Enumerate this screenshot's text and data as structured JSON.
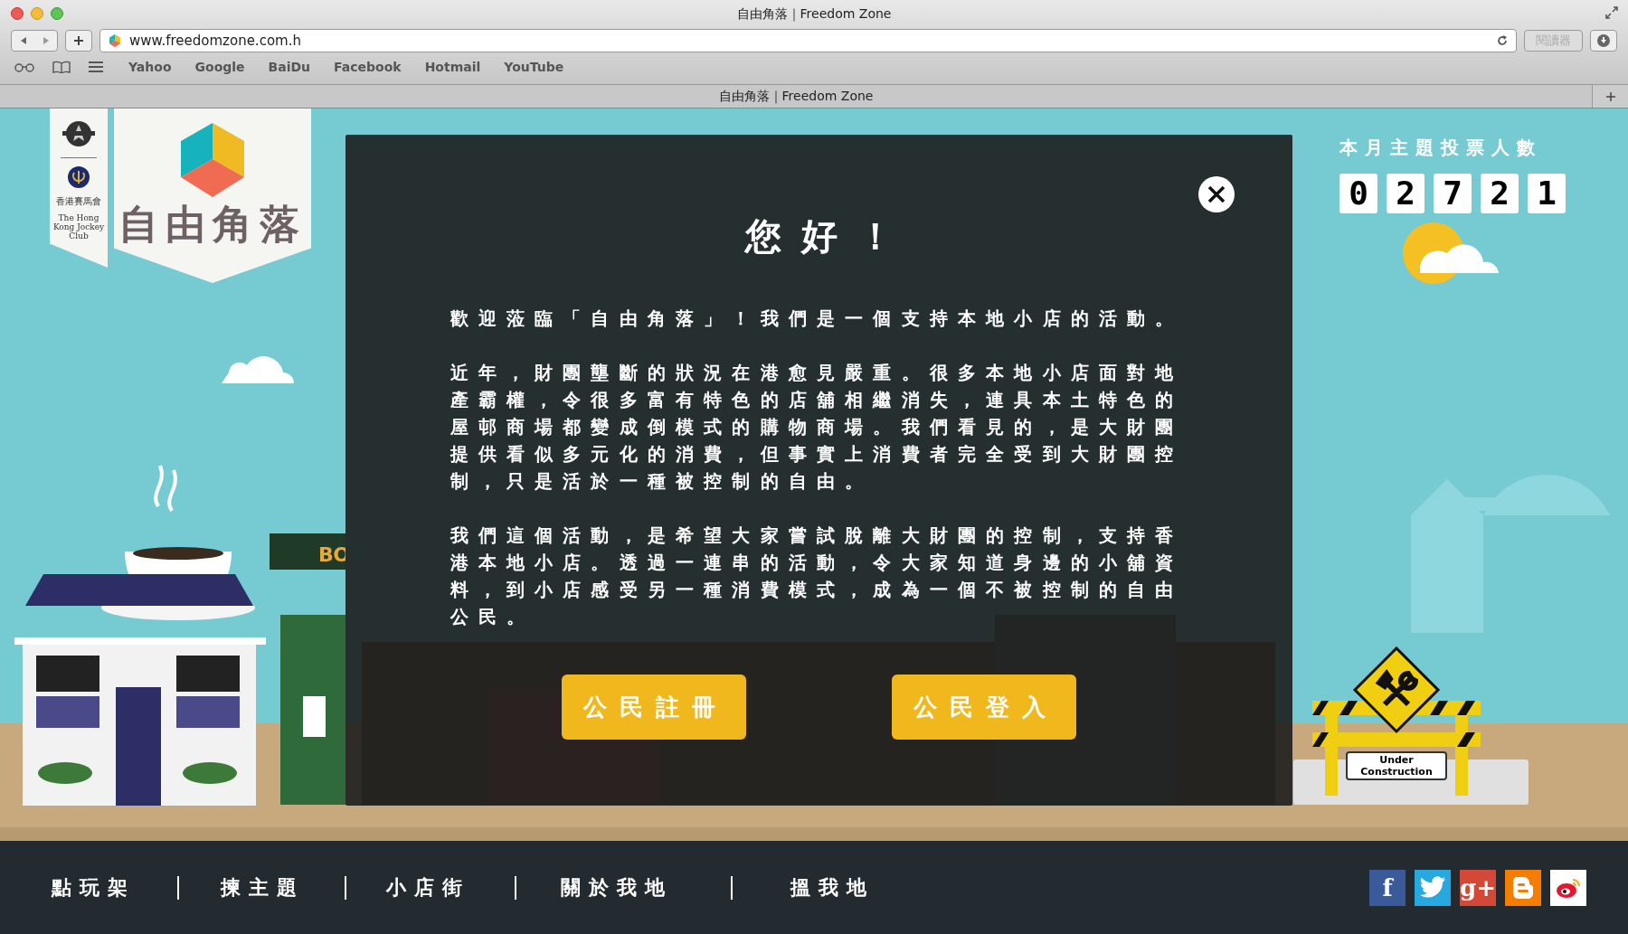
{
  "browser": {
    "window_title": "自由角落｜Freedom Zone",
    "url": "www.freedomzone.com.h",
    "reader_button": "閱讀器",
    "bookmarks": [
      "Yahoo",
      "Google",
      "BaiDu",
      "Facebook",
      "Hotmail",
      "YouTube"
    ],
    "tab_title": "自由角落｜Freedom Zone"
  },
  "sponsor": {
    "chinese": "香港賽馬會",
    "english": "The Hong Kong Jockey Club"
  },
  "logo": {
    "title": "自由角落"
  },
  "vote_counter": {
    "label": "本月主題投票人數",
    "digits": [
      "0",
      "2",
      "7",
      "2",
      "1"
    ]
  },
  "scene": {
    "shop_signs": [
      "BO"
    ],
    "construction_sign": "Under Construction"
  },
  "modal": {
    "title": "您好！",
    "paragraphs": [
      "歡迎蒞臨「自由角落」！我們是一個支持本地小店的活動。",
      "近年，財團壟斷的狀況在港愈見嚴重。很多本地小店面對地產霸權，令很多富有特色的店舖相繼消失，連具本土特色的屋邨商場都變成倒模式的購物商場。我們看見的，是大財團提供看似多元化的消費，但事實上消費者完全受到大財團控制，只是活於一種被控制的自由。",
      "我們這個活動，是希望大家嘗試脫離大財團的控制，支持香港本地小店。透過一連串的活動，令大家知道身邊的小舖資料，到小店感受另一種消費模式，成為一個不被控制的自由公民。"
    ],
    "buttons": [
      "公民註冊",
      "公民登入"
    ]
  },
  "footer": {
    "nav": [
      "點玩架",
      "揀主題",
      "小店街",
      "關於我地",
      "搵我地"
    ],
    "social": [
      {
        "kind": "facebook",
        "glyph": "f"
      },
      {
        "kind": "twitter"
      },
      {
        "kind": "google_plus",
        "glyph": "g+"
      },
      {
        "kind": "blogger"
      },
      {
        "kind": "weibo"
      }
    ]
  }
}
